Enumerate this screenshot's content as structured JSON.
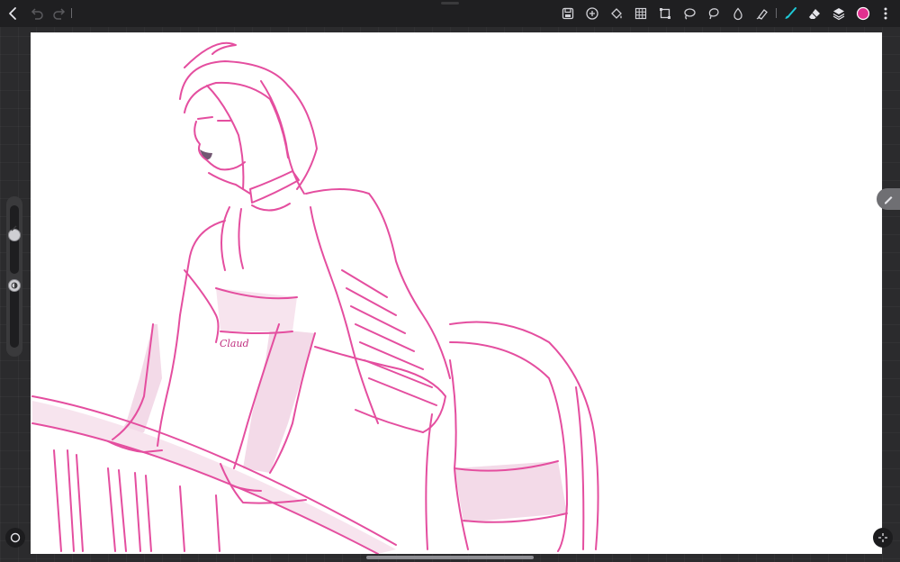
{
  "toolbar": {
    "left_buttons": [
      {
        "icon": "back-icon"
      },
      {
        "icon": "undo-icon"
      },
      {
        "icon": "redo-icon"
      }
    ],
    "right_buttons": [
      {
        "icon": "save-icon"
      },
      {
        "icon": "add-icon"
      },
      {
        "icon": "fill-bucket-icon"
      },
      {
        "icon": "grid-icon"
      },
      {
        "icon": "transform-icon"
      },
      {
        "icon": "lasso-icon"
      },
      {
        "icon": "lasso-fill-icon"
      },
      {
        "icon": "blur-icon"
      },
      {
        "icon": "smudge-icon"
      },
      {
        "icon": "brush-icon"
      },
      {
        "icon": "eraser-icon"
      },
      {
        "icon": "layers-icon"
      },
      {
        "icon": "color-swatch"
      },
      {
        "icon": "more-icon"
      }
    ],
    "active_tool": "brush-icon",
    "accent": "#1ec8d6",
    "current_color": "#e0308f"
  },
  "sidebar": {
    "brush_size_icon": "pencil-icon",
    "opacity_icon": "opacity-icon",
    "brush_size": 0.2,
    "opacity": 0.1
  },
  "canvas": {
    "background": "#ffffff",
    "stroke_color": "#e0308f",
    "signature": "Claud"
  },
  "bottom": {
    "left_icon": "circle-icon",
    "right_icon": "fullscreen-icon"
  },
  "edge_tab_icon": "pencil-icon"
}
